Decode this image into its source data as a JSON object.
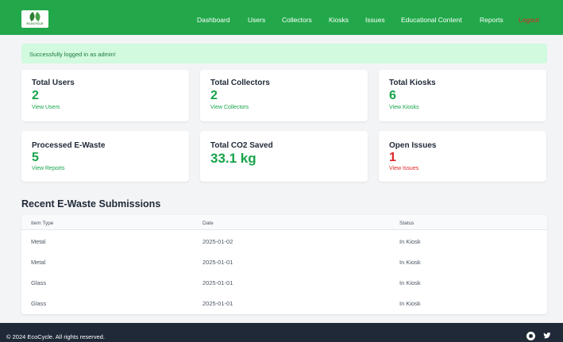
{
  "brand": {
    "logo_text": "ECOCYCLE"
  },
  "nav": {
    "items": [
      {
        "label": "Dashboard"
      },
      {
        "label": "Users"
      },
      {
        "label": "Collectors"
      },
      {
        "label": "Kiosks"
      },
      {
        "label": "Issues"
      },
      {
        "label": "Educational Content"
      },
      {
        "label": "Reports"
      },
      {
        "label": "Logout"
      }
    ]
  },
  "alert": {
    "message": "Successfully logged in as admin!"
  },
  "cards": [
    {
      "title": "Total Users",
      "value": "2",
      "link": "View Users"
    },
    {
      "title": "Total Collectors",
      "value": "2",
      "link": "View Collectors"
    },
    {
      "title": "Total Kiosks",
      "value": "6",
      "link": "View Kiosks"
    },
    {
      "title": "Processed E-Waste",
      "value": "5",
      "link": "View Reports"
    },
    {
      "title": "Total CO2 Saved",
      "value": "33.1 kg",
      "link": ""
    },
    {
      "title": "Open Issues",
      "value": "1",
      "link": "View Issues"
    }
  ],
  "submissions": {
    "title": "Recent E-Waste Submissions",
    "columns": [
      "Item Type",
      "Date",
      "Status"
    ],
    "rows": [
      {
        "item_type": "Metal",
        "date": "2025-01-02",
        "status": "In Kiosk"
      },
      {
        "item_type": "Metal",
        "date": "2025-01-01",
        "status": "In Kiosk"
      },
      {
        "item_type": "Glass",
        "date": "2025-01-01",
        "status": "In Kiosk"
      },
      {
        "item_type": "Glass",
        "date": "2025-01-01",
        "status": "In Kiosk"
      }
    ]
  },
  "footer": {
    "copyright": "© 2024 EcoCycle. All rights reserved.",
    "social_icons": [
      "github-icon",
      "twitter-icon"
    ]
  },
  "colors": {
    "brand_green": "#22a84a",
    "value_green": "#16a34a",
    "alert_bg": "#d1fadf",
    "danger_red": "#dc2626",
    "footer_bg": "#1f2937"
  }
}
